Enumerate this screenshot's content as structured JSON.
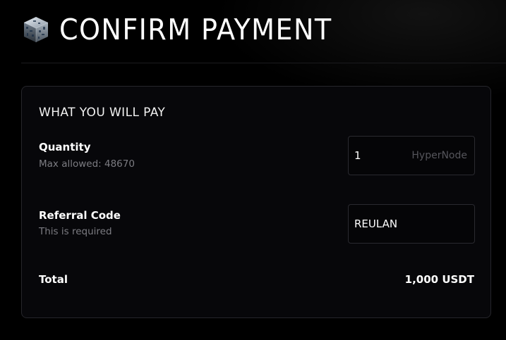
{
  "header": {
    "title": "CONFIRM PAYMENT",
    "logo_icon": "cube-logo-icon"
  },
  "card": {
    "heading": "WHAT YOU WILL PAY",
    "quantity": {
      "label": "Quantity",
      "hint": "Max allowed: 48670",
      "value": "1",
      "suffix": "HyperNode"
    },
    "referral": {
      "label": "Referral Code",
      "hint": "This is required",
      "value": "REULAN"
    },
    "total": {
      "label": "Total",
      "value": "1,000 USDT"
    }
  },
  "colors": {
    "background": "#000000",
    "card_background": "#07070a",
    "card_border": "#26262b",
    "hint_text": "#7c7c82",
    "suffix_text": "#55555b"
  }
}
